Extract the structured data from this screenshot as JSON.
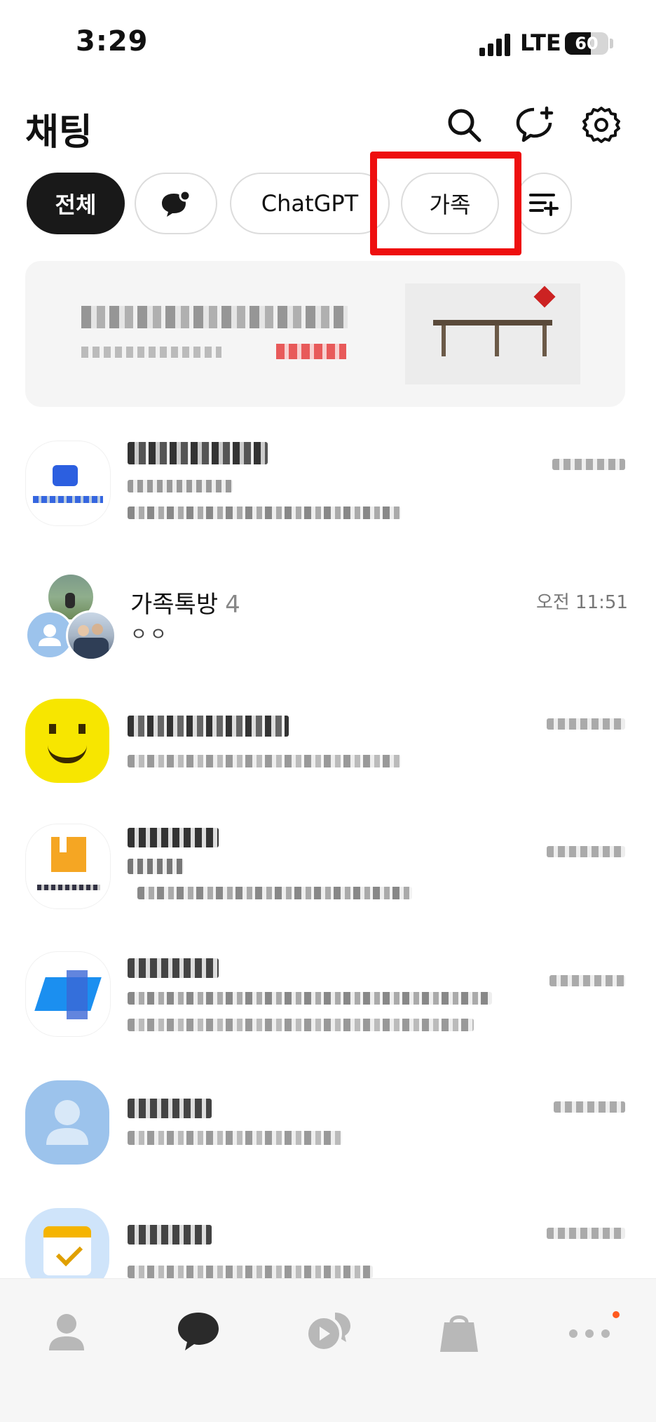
{
  "status_bar": {
    "time": "3:29",
    "network": "LTE",
    "battery": "60",
    "battery_level": 0.6
  },
  "header": {
    "title": "채팅",
    "icons": [
      "search-icon",
      "new-chat-icon",
      "settings-icon"
    ]
  },
  "filters": {
    "chips": [
      {
        "label": "전체",
        "active": true
      },
      {
        "label": "",
        "icon": "open-chat-icon",
        "active": false
      },
      {
        "label": "ChatGPT",
        "active": false
      },
      {
        "label": "가족",
        "active": false
      }
    ],
    "edit_icon": "filter-edit-icon"
  },
  "highlight_color": "#ee0f0f",
  "ad_banner": {
    "content": "blurred-advertisement"
  },
  "chats": [
    {
      "name": "",
      "message": "",
      "time": "",
      "blurred": true
    },
    {
      "name": "가족톡방",
      "count": "4",
      "message": "ㅇㅇ",
      "time": "오전 11:51",
      "blurred": false
    },
    {
      "name": "",
      "message": "",
      "time": "",
      "blurred": true
    },
    {
      "name": "",
      "message": "",
      "time": "",
      "blurred": true
    },
    {
      "name": "",
      "message": "",
      "time": "",
      "blurred": true
    },
    {
      "name": "",
      "message": "",
      "time": "",
      "blurred": true
    },
    {
      "name": "",
      "message": "",
      "time": "",
      "blurred": true
    }
  ],
  "bottom_nav": {
    "items": [
      "friends-icon",
      "chat-icon",
      "open-chat-icon",
      "shopping-icon",
      "more-icon"
    ],
    "active": "chat-icon",
    "badge_color": "#ff5a1f"
  }
}
